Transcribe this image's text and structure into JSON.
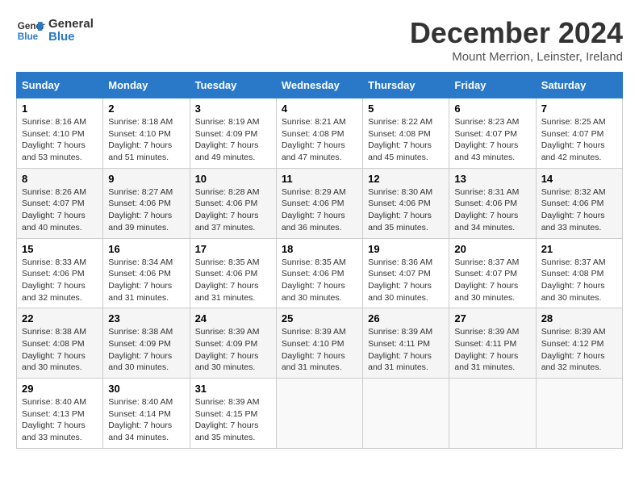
{
  "logo": {
    "line1": "General",
    "line2": "Blue"
  },
  "title": "December 2024",
  "location": "Mount Merrion, Leinster, Ireland",
  "days_header": [
    "Sunday",
    "Monday",
    "Tuesday",
    "Wednesday",
    "Thursday",
    "Friday",
    "Saturday"
  ],
  "weeks": [
    [
      {
        "num": "1",
        "sunrise": "8:16 AM",
        "sunset": "4:10 PM",
        "daylight": "7 hours and 53 minutes."
      },
      {
        "num": "2",
        "sunrise": "8:18 AM",
        "sunset": "4:10 PM",
        "daylight": "7 hours and 51 minutes."
      },
      {
        "num": "3",
        "sunrise": "8:19 AM",
        "sunset": "4:09 PM",
        "daylight": "7 hours and 49 minutes."
      },
      {
        "num": "4",
        "sunrise": "8:21 AM",
        "sunset": "4:08 PM",
        "daylight": "7 hours and 47 minutes."
      },
      {
        "num": "5",
        "sunrise": "8:22 AM",
        "sunset": "4:08 PM",
        "daylight": "7 hours and 45 minutes."
      },
      {
        "num": "6",
        "sunrise": "8:23 AM",
        "sunset": "4:07 PM",
        "daylight": "7 hours and 43 minutes."
      },
      {
        "num": "7",
        "sunrise": "8:25 AM",
        "sunset": "4:07 PM",
        "daylight": "7 hours and 42 minutes."
      }
    ],
    [
      {
        "num": "8",
        "sunrise": "8:26 AM",
        "sunset": "4:07 PM",
        "daylight": "7 hours and 40 minutes."
      },
      {
        "num": "9",
        "sunrise": "8:27 AM",
        "sunset": "4:06 PM",
        "daylight": "7 hours and 39 minutes."
      },
      {
        "num": "10",
        "sunrise": "8:28 AM",
        "sunset": "4:06 PM",
        "daylight": "7 hours and 37 minutes."
      },
      {
        "num": "11",
        "sunrise": "8:29 AM",
        "sunset": "4:06 PM",
        "daylight": "7 hours and 36 minutes."
      },
      {
        "num": "12",
        "sunrise": "8:30 AM",
        "sunset": "4:06 PM",
        "daylight": "7 hours and 35 minutes."
      },
      {
        "num": "13",
        "sunrise": "8:31 AM",
        "sunset": "4:06 PM",
        "daylight": "7 hours and 34 minutes."
      },
      {
        "num": "14",
        "sunrise": "8:32 AM",
        "sunset": "4:06 PM",
        "daylight": "7 hours and 33 minutes."
      }
    ],
    [
      {
        "num": "15",
        "sunrise": "8:33 AM",
        "sunset": "4:06 PM",
        "daylight": "7 hours and 32 minutes."
      },
      {
        "num": "16",
        "sunrise": "8:34 AM",
        "sunset": "4:06 PM",
        "daylight": "7 hours and 31 minutes."
      },
      {
        "num": "17",
        "sunrise": "8:35 AM",
        "sunset": "4:06 PM",
        "daylight": "7 hours and 31 minutes."
      },
      {
        "num": "18",
        "sunrise": "8:35 AM",
        "sunset": "4:06 PM",
        "daylight": "7 hours and 30 minutes."
      },
      {
        "num": "19",
        "sunrise": "8:36 AM",
        "sunset": "4:07 PM",
        "daylight": "7 hours and 30 minutes."
      },
      {
        "num": "20",
        "sunrise": "8:37 AM",
        "sunset": "4:07 PM",
        "daylight": "7 hours and 30 minutes."
      },
      {
        "num": "21",
        "sunrise": "8:37 AM",
        "sunset": "4:08 PM",
        "daylight": "7 hours and 30 minutes."
      }
    ],
    [
      {
        "num": "22",
        "sunrise": "8:38 AM",
        "sunset": "4:08 PM",
        "daylight": "7 hours and 30 minutes."
      },
      {
        "num": "23",
        "sunrise": "8:38 AM",
        "sunset": "4:09 PM",
        "daylight": "7 hours and 30 minutes."
      },
      {
        "num": "24",
        "sunrise": "8:39 AM",
        "sunset": "4:09 PM",
        "daylight": "7 hours and 30 minutes."
      },
      {
        "num": "25",
        "sunrise": "8:39 AM",
        "sunset": "4:10 PM",
        "daylight": "7 hours and 31 minutes."
      },
      {
        "num": "26",
        "sunrise": "8:39 AM",
        "sunset": "4:11 PM",
        "daylight": "7 hours and 31 minutes."
      },
      {
        "num": "27",
        "sunrise": "8:39 AM",
        "sunset": "4:11 PM",
        "daylight": "7 hours and 31 minutes."
      },
      {
        "num": "28",
        "sunrise": "8:39 AM",
        "sunset": "4:12 PM",
        "daylight": "7 hours and 32 minutes."
      }
    ],
    [
      {
        "num": "29",
        "sunrise": "8:40 AM",
        "sunset": "4:13 PM",
        "daylight": "7 hours and 33 minutes."
      },
      {
        "num": "30",
        "sunrise": "8:40 AM",
        "sunset": "4:14 PM",
        "daylight": "7 hours and 34 minutes."
      },
      {
        "num": "31",
        "sunrise": "8:39 AM",
        "sunset": "4:15 PM",
        "daylight": "7 hours and 35 minutes."
      },
      null,
      null,
      null,
      null
    ]
  ],
  "labels": {
    "sunrise": "Sunrise:",
    "sunset": "Sunset:",
    "daylight": "Daylight:"
  }
}
